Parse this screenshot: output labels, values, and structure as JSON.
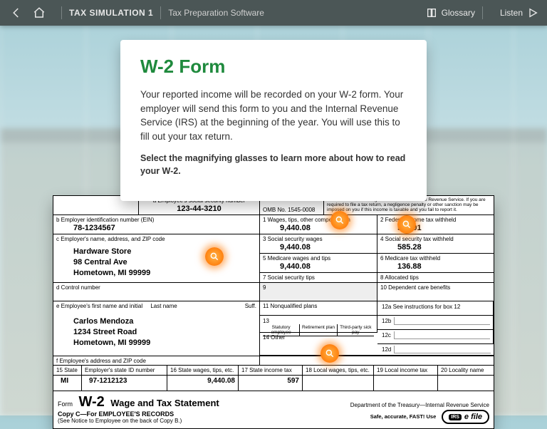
{
  "topbar": {
    "title1": "TAX SIMULATION 1",
    "title2": "Tax Preparation Software",
    "glossary": "Glossary",
    "listen": "Listen"
  },
  "card": {
    "heading": "W-2 Form",
    "paragraph": "Your reported income will be recorded on your W-2 form. Your employer will send this form to you and the Internal Revenue Service (IRS) at the beginning of the year. You will use this to fill out your tax return.",
    "instruction": "Select the magnifying glasses to learn more about how to read your W-2."
  },
  "w2": {
    "box_a_label": "a  Employee's social security number",
    "box_a_value": "123-44-3210",
    "omb": "OMB No. 1545-0008",
    "irs_notice": "This information is being furnished to the Internal Revenue Service. If you are required to file a tax return, a negligence penalty or other sanction may be imposed on you if this income is taxable and you fail to report it.",
    "box_b_label": "b  Employer identification number (EIN)",
    "box_b_value": "78-1234567",
    "box1_label": "1   Wages, tips, other compensation",
    "box1_value": "9,440.08",
    "box2_label": "2   Federal income tax withheld",
    "box2_value": "564.01",
    "box_c_label": "c  Employer's name, address, and ZIP code",
    "employer_name": "Hardware Store",
    "employer_street": "98 Central Ave",
    "employer_city": "Hometown, MI 99999",
    "box3_label": "3   Social security wages",
    "box3_value": "9,440.08",
    "box4_label": "4   Social security tax withheld",
    "box4_value": "585.28",
    "box5_label": "5   Medicare wages and tips",
    "box5_value": "9,440.08",
    "box6_label": "6   Medicare tax withheld",
    "box6_value": "136.88",
    "box7_label": "7   Social security tips",
    "box8_label": "8   Allocated tips",
    "box_d_label": "d  Control number",
    "box9_label": "9",
    "box10_label": "10  Dependent care benefits",
    "box_e_label": "e  Employee's first name and initial",
    "box_e_last": "Last name",
    "box_e_suff": "Suff.",
    "emp_name": "Carlos Mendoza",
    "emp_street": "1234 Street Road",
    "emp_city": "Hometown, MI 99999",
    "box11_label": "11  Nonqualified plans",
    "box12a_label": "12a  See instructions for box 12",
    "box12b_label": "12b",
    "box12c_label": "12c",
    "box12d_label": "12d",
    "box13_label": "13",
    "box13_a": "Statutory employee",
    "box13_b": "Retirement plan",
    "box13_c": "Third-party sick pay",
    "box14_label": "14  Other",
    "box_f_label": "f  Employee's address and ZIP code",
    "box15_label": "15  State",
    "box15_id_label": "Employer's state ID number",
    "box15_state": "MI",
    "box15_id": "97-1212123",
    "box16_label": "16  State wages, tips, etc.",
    "box16_value": "9,440.08",
    "box17_label": "17  State income tax",
    "box17_value": "597",
    "box18_label": "18  Local wages, tips, etc.",
    "box19_label": "19  Local income tax",
    "box20_label": "20  Locality name",
    "form_label": "Form",
    "form_name": "W-2",
    "form_title": "Wage and Tax Statement",
    "copy_line": "Copy C—For EMPLOYEE'S RECORDS",
    "notice_line": "(See Notice to Employee on the back of Copy B.)",
    "dept": "Department of the Treasury—Internal Revenue Service",
    "safe": "Safe, accurate, FAST! Use",
    "efile": "e file",
    "irs_badge": "IRS"
  }
}
